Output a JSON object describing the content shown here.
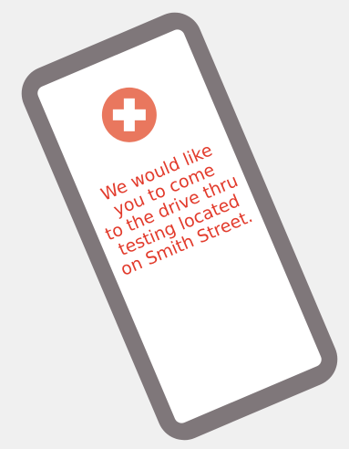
{
  "message": {
    "lines": [
      "We would like",
      "you to come",
      "to the drive thru",
      "testing located",
      "on Smith Street."
    ]
  },
  "icon": {
    "name": "medical-cross-icon",
    "badge_color": "#e9775e",
    "cross_color": "#ffffff"
  },
  "colors": {
    "background": "#f0f0f0",
    "phone_frame": "#7f777a",
    "screen": "#ffffff",
    "text": "#e23b2c"
  }
}
